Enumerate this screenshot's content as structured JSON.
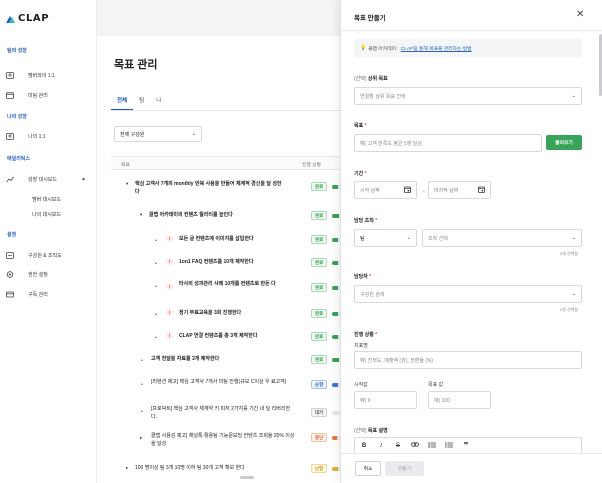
{
  "sidebar": {
    "logo": "CLAP",
    "sections": [
      {
        "title": "팀의 성장",
        "items": [
          {
            "label": "멤버와의 1:1",
            "icon": "people-icon"
          },
          {
            "label": "미팅 관리",
            "icon": "calendar-icon"
          }
        ]
      },
      {
        "title": "나의 성장",
        "items": [
          {
            "label": "나의 1:1",
            "icon": "people-icon"
          }
        ]
      },
      {
        "title": "애널리틱스",
        "items": [
          {
            "label": "성장 대시보드",
            "icon": "trend-icon"
          }
        ],
        "subitems": [
          "멤버 대시보드",
          "나의 대시보드"
        ]
      },
      {
        "title": "설정",
        "items": [
          {
            "label": "구성원 & 조직도",
            "icon": "org-icon"
          },
          {
            "label": "권한 설정",
            "icon": "gear-icon"
          },
          {
            "label": "구독 관리",
            "icon": "card-icon"
          }
        ]
      }
    ]
  },
  "main": {
    "title": "목표 관리",
    "tabs": [
      "전체",
      "팀",
      "나"
    ],
    "filter": "전체 구성원",
    "table_headers": [
      "목표",
      "진행 상황"
    ],
    "rows": [
      {
        "text": "핵심 고객사 7개의 monthly 반복 사용을 만들어 체계적 경신을 달 성한다",
        "status": "완료",
        "progress": 0.3
      },
      {
        "text": "클랩 아카데미의 컨텐츠 퀄리티를 높인다",
        "status": "완료",
        "progress": 0.35
      },
      {
        "text": "모든 글 컨텐츠에 이미지를 삽입한다",
        "status": "완료",
        "progress": 0.3
      },
      {
        "text": "1on1 FAQ 컨텐츠를 10개 제작한다",
        "status": "완료",
        "progress": 0.3
      },
      {
        "text": "타사의 성과관리 사례 10개를 컨텐츠로 만든 다",
        "status": "완료",
        "progress": 0.3
      },
      {
        "text": "정기 무료교육을 3회 진행한다",
        "status": "완료",
        "progress": 0.3
      },
      {
        "text": "CLAP 연결 컨텐츠를 총 3개 제작한다",
        "status": "완료",
        "progress": 0.3
      },
      {
        "text": "고객 전달을 자료를 3개 제작한다",
        "status": "완료",
        "progress": 0.35
      },
      {
        "text": "[리텐션 제고] 핵심 고객사 7개사 미팅 진행(규모 C이상 우 료고객)",
        "status": "순항",
        "progress": 0.3
      },
      {
        "text": "[프로덕트] 핵심 고객사 체계약 키 피처 2가지를 기간 내 딜 리버리한다.",
        "status": "대기",
        "progress": 0.0
      },
      {
        "text": "클랩 사용성 제고] 채널톡 활용팀 기능문보딩 컨텐츠 조회율 20% 이상을 달성",
        "status": "중단",
        "progress": 0.25
      },
      {
        "text": "100 명이상 팀 3개 10명 이하 팀 30개 고객 확보 한다",
        "status": "난항",
        "progress": 0.3
      }
    ]
  },
  "drawer": {
    "title": "목표 만들기",
    "info_prefix": "클랩 아카데미 :",
    "info_link": "CLAP팀 통해 목표를 관리하는 방법",
    "parent_goal": {
      "label": "상위 목표",
      "label_prefix": "(선택)",
      "placeholder": "연결할 상위 목표 선택"
    },
    "goal": {
      "label": "목표",
      "placeholder": "예) 고객 만족도 평균 5점 달성",
      "button": "불러오기"
    },
    "period": {
      "label": "기간",
      "start_placeholder": "시작 날짜",
      "end_placeholder": "마지막 날짜"
    },
    "org": {
      "label": "담당 조직",
      "type_value": "팀",
      "org_placeholder": "조직 선택",
      "hint": "0개 선택됨"
    },
    "owner": {
      "label": "담당자",
      "placeholder": "구성원 검색",
      "hint": "0명 선택됨"
    },
    "progress": {
      "label": "진행 상황",
      "metric_label": "지표명",
      "metric_placeholder": "예) 진척도, 매출액 (원), 전환율 (%)",
      "start_label": "시작값",
      "start_placeholder": "예) 0",
      "target_label": "목표 값",
      "target_placeholder": "예) 100"
    },
    "description": {
      "label": "목표 설명",
      "label_prefix": "(선택)",
      "toolbar": [
        "B",
        "I",
        "S",
        "link",
        "ul",
        "ol",
        "quote"
      ]
    },
    "cancel_label": "취소",
    "create_label": "만들기"
  },
  "colors": {
    "accent": "#1e56c2",
    "green": "#3aa35a",
    "required": "#e0453a"
  }
}
